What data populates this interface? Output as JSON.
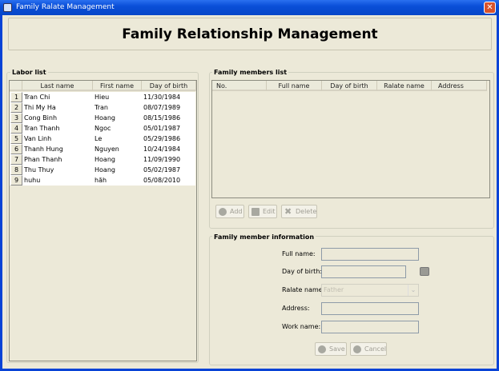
{
  "window": {
    "title": "Family Ralate Management"
  },
  "header": {
    "title": "Family Relationship Management"
  },
  "labor_list": {
    "label": "Labor list",
    "columns": [
      "Last name",
      "First name",
      "Day of birth"
    ],
    "rows": [
      {
        "no": "1",
        "last": "Tran Chi",
        "first": "Hieu",
        "dob": "11/30/1984"
      },
      {
        "no": "2",
        "last": "Thi My Ha",
        "first": "Tran",
        "dob": "08/07/1989"
      },
      {
        "no": "3",
        "last": "Cong Binh",
        "first": "Hoang",
        "dob": "08/15/1986"
      },
      {
        "no": "4",
        "last": "Tran Thanh",
        "first": "Ngoc",
        "dob": "05/01/1987"
      },
      {
        "no": "5",
        "last": "Van Linh",
        "first": "Le",
        "dob": "05/29/1986"
      },
      {
        "no": "6",
        "last": "Thanh Hung",
        "first": "Nguyen",
        "dob": "10/24/1984"
      },
      {
        "no": "7",
        "last": "Phan Thanh",
        "first": "Hoang",
        "dob": "11/09/1990"
      },
      {
        "no": "8",
        "last": "Thu Thuy",
        "first": "Hoang",
        "dob": "05/02/1987"
      },
      {
        "no": "9",
        "last": "huhu",
        "first": "hăh",
        "dob": "05/08/2010"
      }
    ]
  },
  "family_list": {
    "label": "Family members list",
    "columns": [
      "No.",
      "Full name",
      "Day of birth",
      "Ralate name",
      "Address"
    ],
    "buttons": {
      "add": "Add",
      "edit": "Edit",
      "delete": "Delete"
    }
  },
  "info": {
    "label": "Family member information",
    "full_name": "Full name:",
    "dob": "Day of birth:",
    "relate": "Ralate name:",
    "relate_value": "Father",
    "address": "Address:",
    "work": "Work name:",
    "save": "Save",
    "cancel": "Cancel"
  }
}
